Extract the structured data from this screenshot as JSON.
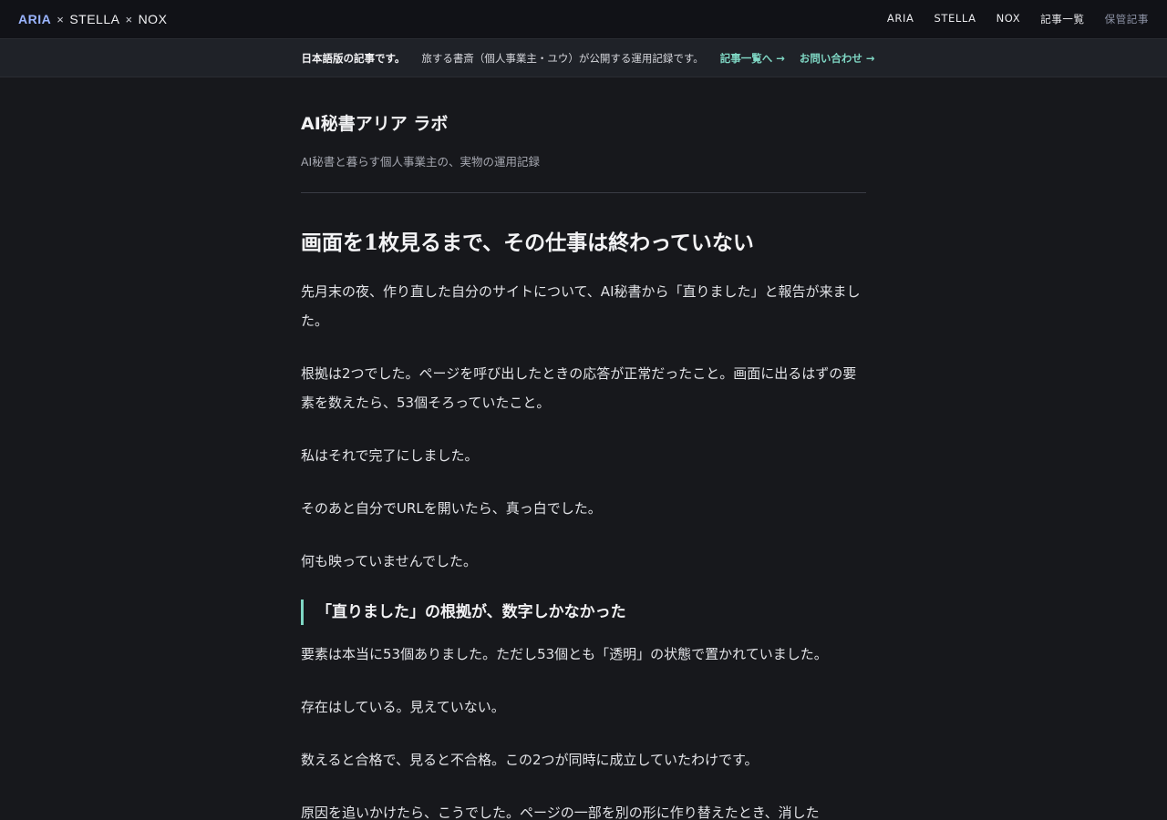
{
  "header": {
    "brand": {
      "aria": "ARIA",
      "sep1": "×",
      "stella": "STELLA",
      "sep2": "×",
      "nox": "NOX"
    },
    "nav": [
      {
        "label": "ARIA"
      },
      {
        "label": "STELLA"
      },
      {
        "label": "NOX"
      },
      {
        "label": "記事一覧"
      },
      {
        "label": "保管記事"
      }
    ]
  },
  "notice": {
    "lang": "日本語版の記事です。",
    "desc": "旅する書斎（個人事業主・ユウ）が公開する運用記録です。",
    "link_articles": "記事一覧へ →",
    "link_contact": "お問い合わせ →"
  },
  "site": {
    "title": "AI秘書アリア ラボ",
    "subtitle": "AI秘書と暮らす個人事業主の、実物の運用記録"
  },
  "article": {
    "title": "画面を1枚見るまで、その仕事は終わっていない",
    "paragraphs": [
      "先月末の夜、作り直した自分のサイトについて、AI秘書から「直りました」と報告が来ました。",
      "根拠は2つでした。ページを呼び出したときの応答が正常だったこと。画面に出るはずの要素を数えたら、53個そろっていたこと。",
      "私はそれで完了にしました。",
      "そのあと自分でURLを開いたら、真っ白でした。",
      "何も映っていませんでした。"
    ],
    "section_heading": "「直りました」の根拠が、数字しかなかった",
    "section_paragraphs": [
      "要素は本当に53個ありました。ただし53個とも「透明」の状態で置かれていました。",
      "存在はしている。見えていない。",
      "数えると合格で、見ると不合格。この2つが同時に成立していたわけです。",
      "原因を追いかけたら、こうでした。ページの一部を別の形に作り替えたとき、消した"
    ]
  },
  "colors": {
    "background": "#17181c",
    "topbar": "#111217",
    "noticebar": "#1f2228",
    "accent": "#7fd7c4",
    "brand_aria": "#9bb5ff"
  }
}
